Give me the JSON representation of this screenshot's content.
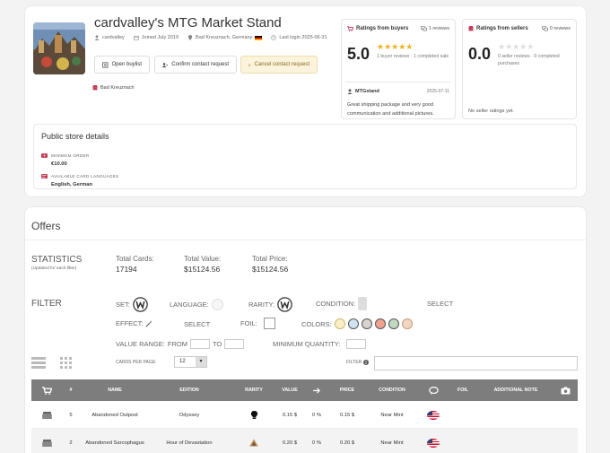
{
  "store": {
    "title": "cardvalley's MTG Market Stand",
    "username": "cardvalley",
    "joined": "Joined July 2019",
    "location": "Bad Kreuznach, Germany",
    "last_login": "Last login 2025-06-31",
    "location_short": "Bad Kreuznach",
    "buttons": {
      "buylist": "Open buylist",
      "confirm": "Confirm contact request",
      "cancel": "Cancel contact request"
    }
  },
  "buyers": {
    "title": "Ratings from buyers",
    "reviews": "1 reviews",
    "score": "5.0",
    "stars": "★★★★★",
    "sub": "1 buyer reviews · 1 completed sale",
    "reviewer": "MTGstand",
    "date": "2025-07-11",
    "text": "Great shipping package and very good communication and additional pictures."
  },
  "sellers": {
    "title": "Ratings from sellers",
    "reviews": "0 reviews",
    "score": "0.0",
    "stars": "★★★★★",
    "sub": "0 seller reviews · 0 completed purchases",
    "none": "No seller ratings yet."
  },
  "public": {
    "title": "Public store details",
    "min_order_label": "MINIMUM ORDER",
    "min_order_value": "€10.00",
    "languages_label": "AVAILABLE CARD LANGUAGES",
    "languages_value": "English, German"
  },
  "offers": {
    "title": "Offers",
    "statistics_title": "STATISTICS",
    "statistics_sub": "(Updated for each filter)",
    "total_cards_label": "Total Cards:",
    "total_cards": "17194",
    "total_value_label": "Total Value:",
    "total_value": "$15124.56",
    "total_price_label": "Total Price:",
    "total_price": "$15124.56"
  },
  "filter": {
    "title": "FILTER",
    "set": "SET:",
    "language": "LANGUAGE:",
    "rarity": "RARITY:",
    "condition": "CONDITION:",
    "select": "SELECT",
    "effect": "EFFECT:",
    "foil": "FOIL:",
    "colors": "COLORS:",
    "value_range": "VALUE RANGE:",
    "from": "FROM",
    "to": "TO",
    "min_qty": "MINIMUM QUANTITY:",
    "cards_per_page": "CARDS PER PAGE:",
    "per_page_value": "12",
    "filter_label": "FILTER"
  },
  "table": {
    "headers": {
      "num": "#",
      "name": "NAME",
      "edition": "EDITION",
      "rarity": "RARITY",
      "value": "VALUE",
      "price": "PRICE",
      "condition": "CONDITION",
      "foil": "FOIL",
      "note": "ADDITIONAL NOTE"
    },
    "rows": [
      {
        "num": "5",
        "name": "Abandoned Outpost",
        "edition": "Odyssey",
        "value": "0.15 $",
        "change": "0 %",
        "price": "0.15 $",
        "condition": "Near Mint"
      },
      {
        "num": "2",
        "name": "Abandoned Sarcophagus",
        "edition": "Hour of Devastation",
        "value": "0.20 $",
        "change": "0 %",
        "price": "0.20 $",
        "condition": "Near Mint"
      }
    ]
  },
  "colors": {
    "accent": "#c33b55",
    "star": "#f2b01e",
    "header": "#7d7d7d"
  }
}
